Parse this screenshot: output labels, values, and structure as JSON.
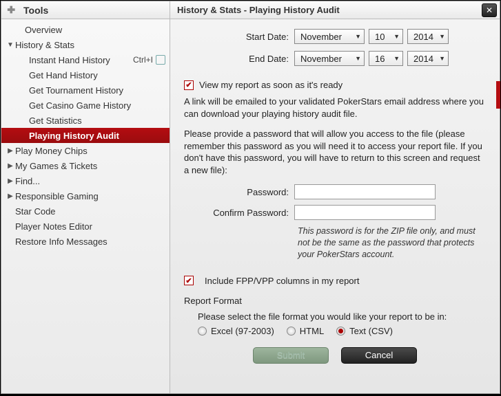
{
  "sidebar": {
    "title": "Tools",
    "items": [
      {
        "label": "Overview"
      },
      {
        "label": "History & Stats",
        "expanded": true,
        "children": [
          {
            "label": "Instant Hand History",
            "shortcut": "Ctrl+I"
          },
          {
            "label": "Get Hand History"
          },
          {
            "label": "Get Tournament History"
          },
          {
            "label": "Get Casino Game History"
          },
          {
            "label": "Get Statistics"
          },
          {
            "label": "Playing History Audit",
            "selected": true
          }
        ]
      },
      {
        "label": "Play Money Chips"
      },
      {
        "label": "My Games & Tickets"
      },
      {
        "label": "Find..."
      },
      {
        "label": "Responsible Gaming"
      },
      {
        "label": "Star Code"
      },
      {
        "label": "Player Notes Editor"
      },
      {
        "label": "Restore Info Messages"
      }
    ]
  },
  "header": {
    "title": "History & Stats - Playing History Audit"
  },
  "form": {
    "start_date": {
      "label": "Start Date:",
      "month": "November",
      "day": "10",
      "year": "2014"
    },
    "end_date": {
      "label": "End Date:",
      "month": "November",
      "day": "16",
      "year": "2014"
    },
    "view_ready": {
      "checked": true,
      "label": "View my report as soon as it's ready"
    },
    "email_info": "A link will be emailed to your validated PokerStars email address where you can download your playing history audit file.",
    "password_info": "Please provide a password that will allow you access to the file (please remember this password as you will need it to access your report file. If you don't have this password, you will have to return to this screen and request a new file):",
    "password": {
      "label": "Password:",
      "value": ""
    },
    "confirm_password": {
      "label": "Confirm Password:",
      "value": ""
    },
    "password_hint": "This password is for the ZIP file only, and must not be the same as the password that protects your PokerStars account.",
    "include_fpp": {
      "checked": true,
      "label": "Include FPP/VPP columns in my report"
    },
    "report_format": {
      "title": "Report Format",
      "prompt": "Please select the file format you would like your report to be in:",
      "options": [
        "Excel (97-2003)",
        "HTML",
        "Text (CSV)"
      ],
      "selected": "Text (CSV)"
    }
  },
  "buttons": {
    "submit": "Submit",
    "cancel": "Cancel"
  }
}
